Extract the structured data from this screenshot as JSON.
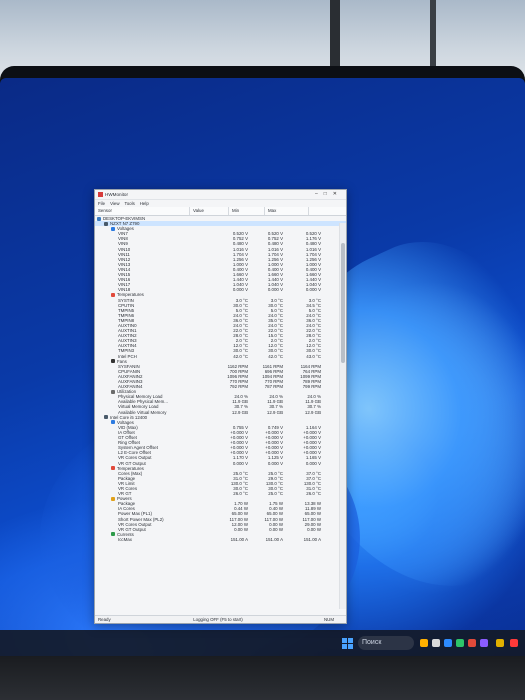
{
  "window": {
    "title": "HWMonitor",
    "menu": [
      "File",
      "View",
      "Tools",
      "Help"
    ],
    "columns": [
      "Sensor",
      "Value",
      "Min",
      "Max"
    ],
    "status": {
      "ready": "Ready",
      "logging": "Logging OFF (F5 to start)",
      "num": "NUM"
    }
  },
  "taskbar": {
    "search_placeholder": "Поиск"
  },
  "rows": [
    {
      "n": "DESKTOP-EKVIMSN",
      "ind": 0,
      "icon": "pc",
      "v": "",
      "mn": "",
      "mx": ""
    },
    {
      "n": "NZXT N7 Z790",
      "ind": 1,
      "icon": "dev",
      "v": "",
      "mn": "",
      "mx": ""
    },
    {
      "n": "Voltages",
      "ind": 2,
      "icon": "volt",
      "v": "",
      "mn": "",
      "mx": ""
    },
    {
      "n": "VIN7",
      "ind": 3,
      "v": "0.520 V",
      "mn": "0.520 V",
      "mx": "0.520 V"
    },
    {
      "n": "VIN8",
      "ind": 3,
      "v": "0.752 V",
      "mn": "0.752 V",
      "mx": "1.176 V"
    },
    {
      "n": "VIN9",
      "ind": 3,
      "v": "0.480 V",
      "mn": "0.480 V",
      "mx": "0.480 V"
    },
    {
      "n": "VIN10",
      "ind": 3,
      "v": "1.016 V",
      "mn": "1.016 V",
      "mx": "1.016 V"
    },
    {
      "n": "VIN11",
      "ind": 3,
      "v": "1.704 V",
      "mn": "1.704 V",
      "mx": "1.704 V"
    },
    {
      "n": "VIN12",
      "ind": 3,
      "v": "1.256 V",
      "mn": "1.256 V",
      "mx": "1.256 V"
    },
    {
      "n": "VIN13",
      "ind": 3,
      "v": "1.000 V",
      "mn": "1.000 V",
      "mx": "1.000 V"
    },
    {
      "n": "VIN14",
      "ind": 3,
      "v": "0.400 V",
      "mn": "0.400 V",
      "mx": "0.400 V"
    },
    {
      "n": "VIN15",
      "ind": 3,
      "v": "1.660 V",
      "mn": "1.660 V",
      "mx": "1.660 V"
    },
    {
      "n": "VIN16",
      "ind": 3,
      "v": "1.440 V",
      "mn": "1.440 V",
      "mx": "1.440 V"
    },
    {
      "n": "VIN17",
      "ind": 3,
      "v": "1.040 V",
      "mn": "1.040 V",
      "mx": "1.040 V"
    },
    {
      "n": "VIN18",
      "ind": 3,
      "v": "0.000 V",
      "mn": "0.000 V",
      "mx": "0.000 V"
    },
    {
      "n": "Temperatures",
      "ind": 2,
      "icon": "temp",
      "v": "",
      "mn": "",
      "mx": ""
    },
    {
      "n": "SYSTIN",
      "ind": 3,
      "v": "3.0 °C",
      "mn": "3.0 °C",
      "mx": "3.0 °C"
    },
    {
      "n": "CPUTIN",
      "ind": 3,
      "v": "30.0 °C",
      "mn": "30.0 °C",
      "mx": "34.5 °C"
    },
    {
      "n": "TMPIN5",
      "ind": 3,
      "v": "5.0 °C",
      "mn": "5.0 °C",
      "mx": "5.0 °C"
    },
    {
      "n": "TMPIN6",
      "ind": 3,
      "v": "24.0 °C",
      "mn": "24.0 °C",
      "mx": "24.0 °C"
    },
    {
      "n": "TMPIN8",
      "ind": 3,
      "v": "36.0 °C",
      "mn": "35.0 °C",
      "mx": "36.0 °C"
    },
    {
      "n": "AUXTIN0",
      "ind": 3,
      "v": "24.0 °C",
      "mn": "24.0 °C",
      "mx": "24.0 °C"
    },
    {
      "n": "AUXTIN1",
      "ind": 3,
      "v": "22.0 °C",
      "mn": "22.0 °C",
      "mx": "22.0 °C"
    },
    {
      "n": "AUXTIN2",
      "ind": 3,
      "v": "28.0 °C",
      "mn": "15.0 °C",
      "mx": "28.0 °C"
    },
    {
      "n": "AUXTIN3",
      "ind": 3,
      "v": "2.0 °C",
      "mn": "2.0 °C",
      "mx": "2.0 °C"
    },
    {
      "n": "AUXTIN4",
      "ind": 3,
      "v": "12.0 °C",
      "mn": "12.0 °C",
      "mx": "12.0 °C"
    },
    {
      "n": "TMPIN3",
      "ind": 3,
      "v": "30.0 °C",
      "mn": "30.0 °C",
      "mx": "30.0 °C"
    },
    {
      "n": "Intel PCH",
      "ind": 3,
      "v": "42.0 °C",
      "mn": "42.0 °C",
      "mx": "43.0 °C"
    },
    {
      "n": "Fans",
      "ind": 2,
      "icon": "fan",
      "v": "",
      "mn": "",
      "mx": ""
    },
    {
      "n": "SYSFANIN",
      "ind": 3,
      "v": "1162 RPM",
      "mn": "1161 RPM",
      "mx": "1164 RPM"
    },
    {
      "n": "CPUFANIN",
      "ind": 3,
      "v": "700 RPM",
      "mn": "696 RPM",
      "mx": "764 RPM"
    },
    {
      "n": "AUXFANIN2",
      "ind": 3,
      "v": "1096 RPM",
      "mn": "1094 RPM",
      "mx": "1099 RPM"
    },
    {
      "n": "AUXFANIN3",
      "ind": 3,
      "v": "770 RPM",
      "mn": "770 RPM",
      "mx": "789 RPM"
    },
    {
      "n": "AUXFANIN4",
      "ind": 3,
      "v": "792 RPM",
      "mn": "787 RPM",
      "mx": "799 RPM"
    },
    {
      "n": "Utilization",
      "ind": 2,
      "icon": "util",
      "v": "",
      "mn": "",
      "mx": ""
    },
    {
      "n": "Physical Memory Load",
      "ind": 3,
      "v": "24.0 %",
      "mn": "24.0 %",
      "mx": "24.0 %"
    },
    {
      "n": "Available Physical Mem...",
      "ind": 3,
      "v": "11.9 GB",
      "mn": "11.9 GB",
      "mx": "11.9 GB"
    },
    {
      "n": "Virtual Memory Load",
      "ind": 3,
      "v": "30.7 %",
      "mn": "30.7 %",
      "mx": "30.7 %"
    },
    {
      "n": "Available Virtual Memory",
      "ind": 3,
      "v": "12.9 GB",
      "mn": "12.9 GB",
      "mx": "12.9 GB"
    },
    {
      "n": "Intel Core i5 12400",
      "ind": 1,
      "icon": "dev",
      "v": "",
      "mn": "",
      "mx": ""
    },
    {
      "n": "Voltages",
      "ind": 2,
      "icon": "volt",
      "v": "",
      "mn": "",
      "mx": ""
    },
    {
      "n": "VID (Max)",
      "ind": 3,
      "v": "0.755 V",
      "mn": "0.749 V",
      "mx": "1.164 V"
    },
    {
      "n": "IA Offset",
      "ind": 3,
      "v": "+0.000 V",
      "mn": "+0.000 V",
      "mx": "+0.000 V"
    },
    {
      "n": "GT Offset",
      "ind": 3,
      "v": "+0.000 V",
      "mn": "+0.000 V",
      "mx": "+0.000 V"
    },
    {
      "n": "Ring Offset",
      "ind": 3,
      "v": "+0.000 V",
      "mn": "+0.000 V",
      "mx": "+0.000 V"
    },
    {
      "n": "System Agent Offset",
      "ind": 3,
      "v": "+0.000 V",
      "mn": "+0.000 V",
      "mx": "+0.000 V"
    },
    {
      "n": "L2 E-Core Offset",
      "ind": 3,
      "v": "+0.000 V",
      "mn": "+0.000 V",
      "mx": "+0.000 V"
    },
    {
      "n": "VR Cores Output",
      "ind": 3,
      "v": "1.170 V",
      "mn": "1.125 V",
      "mx": "1.165 V"
    },
    {
      "n": "VR GT Output",
      "ind": 3,
      "v": "0.000 V",
      "mn": "0.000 V",
      "mx": "0.000 V"
    },
    {
      "n": "Temperatures",
      "ind": 2,
      "icon": "temp",
      "v": "",
      "mn": "",
      "mx": ""
    },
    {
      "n": "Cores (Max)",
      "ind": 3,
      "v": "25.0 °C",
      "mn": "25.0 °C",
      "mx": "37.0 °C"
    },
    {
      "n": "Package",
      "ind": 3,
      "v": "31.0 °C",
      "mn": "29.0 °C",
      "mx": "37.0 °C"
    },
    {
      "n": "VR Limit",
      "ind": 3,
      "v": "130.0 °C",
      "mn": "130.0 °C",
      "mx": "130.0 °C"
    },
    {
      "n": "VR Cores",
      "ind": 3,
      "v": "30.0 °C",
      "mn": "30.0 °C",
      "mx": "31.0 °C"
    },
    {
      "n": "VR GT",
      "ind": 3,
      "v": "26.0 °C",
      "mn": "25.0 °C",
      "mx": "26.0 °C"
    },
    {
      "n": "Powers",
      "ind": 2,
      "icon": "pow",
      "v": "",
      "mn": "",
      "mx": ""
    },
    {
      "n": "Package",
      "ind": 3,
      "v": "1.70 W",
      "mn": "1.75 W",
      "mx": "13.38 W"
    },
    {
      "n": "IA Cores",
      "ind": 3,
      "v": "0.44 W",
      "mn": "0.40 W",
      "mx": "11.89 W"
    },
    {
      "n": "Power Max (PL1)",
      "ind": 3,
      "v": "65.00 W",
      "mn": "65.00 W",
      "mx": "65.00 W"
    },
    {
      "n": "Short Power Max (PL2)",
      "ind": 3,
      "v": "117.00 W",
      "mn": "117.00 W",
      "mx": "117.00 W"
    },
    {
      "n": "VR Cores Output",
      "ind": 3,
      "v": "12.00 W",
      "mn": "0.00 W",
      "mx": "29.00 W"
    },
    {
      "n": "VR GT Output",
      "ind": 3,
      "v": "0.00 W",
      "mn": "0.00 W",
      "mx": "0.00 W"
    },
    {
      "n": "Currents",
      "ind": 2,
      "icon": "cur",
      "v": "",
      "mn": "",
      "mx": ""
    },
    {
      "n": "IccMax",
      "ind": 3,
      "v": "151.00 A",
      "mn": "151.00 A",
      "mx": "151.00 A"
    }
  ]
}
